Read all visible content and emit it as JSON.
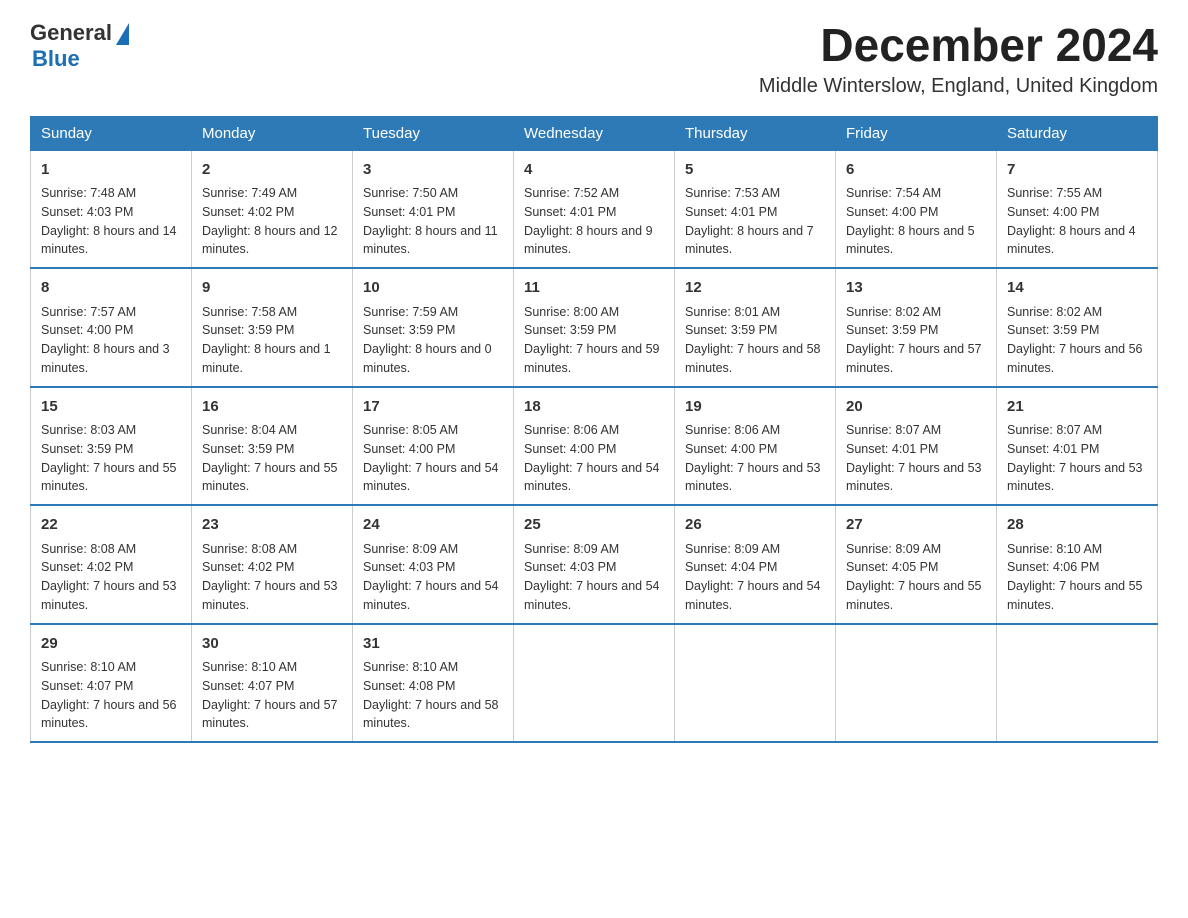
{
  "header": {
    "logo": {
      "general": "General",
      "arrow": "▶",
      "blue": "Blue"
    },
    "title": "December 2024",
    "subtitle": "Middle Winterslow, England, United Kingdom"
  },
  "calendar": {
    "days_of_week": [
      "Sunday",
      "Monday",
      "Tuesday",
      "Wednesday",
      "Thursday",
      "Friday",
      "Saturday"
    ],
    "weeks": [
      [
        {
          "day": "1",
          "sunrise": "7:48 AM",
          "sunset": "4:03 PM",
          "daylight": "8 hours and 14 minutes."
        },
        {
          "day": "2",
          "sunrise": "7:49 AM",
          "sunset": "4:02 PM",
          "daylight": "8 hours and 12 minutes."
        },
        {
          "day": "3",
          "sunrise": "7:50 AM",
          "sunset": "4:01 PM",
          "daylight": "8 hours and 11 minutes."
        },
        {
          "day": "4",
          "sunrise": "7:52 AM",
          "sunset": "4:01 PM",
          "daylight": "8 hours and 9 minutes."
        },
        {
          "day": "5",
          "sunrise": "7:53 AM",
          "sunset": "4:01 PM",
          "daylight": "8 hours and 7 minutes."
        },
        {
          "day": "6",
          "sunrise": "7:54 AM",
          "sunset": "4:00 PM",
          "daylight": "8 hours and 5 minutes."
        },
        {
          "day": "7",
          "sunrise": "7:55 AM",
          "sunset": "4:00 PM",
          "daylight": "8 hours and 4 minutes."
        }
      ],
      [
        {
          "day": "8",
          "sunrise": "7:57 AM",
          "sunset": "4:00 PM",
          "daylight": "8 hours and 3 minutes."
        },
        {
          "day": "9",
          "sunrise": "7:58 AM",
          "sunset": "3:59 PM",
          "daylight": "8 hours and 1 minute."
        },
        {
          "day": "10",
          "sunrise": "7:59 AM",
          "sunset": "3:59 PM",
          "daylight": "8 hours and 0 minutes."
        },
        {
          "day": "11",
          "sunrise": "8:00 AM",
          "sunset": "3:59 PM",
          "daylight": "7 hours and 59 minutes."
        },
        {
          "day": "12",
          "sunrise": "8:01 AM",
          "sunset": "3:59 PM",
          "daylight": "7 hours and 58 minutes."
        },
        {
          "day": "13",
          "sunrise": "8:02 AM",
          "sunset": "3:59 PM",
          "daylight": "7 hours and 57 minutes."
        },
        {
          "day": "14",
          "sunrise": "8:02 AM",
          "sunset": "3:59 PM",
          "daylight": "7 hours and 56 minutes."
        }
      ],
      [
        {
          "day": "15",
          "sunrise": "8:03 AM",
          "sunset": "3:59 PM",
          "daylight": "7 hours and 55 minutes."
        },
        {
          "day": "16",
          "sunrise": "8:04 AM",
          "sunset": "3:59 PM",
          "daylight": "7 hours and 55 minutes."
        },
        {
          "day": "17",
          "sunrise": "8:05 AM",
          "sunset": "4:00 PM",
          "daylight": "7 hours and 54 minutes."
        },
        {
          "day": "18",
          "sunrise": "8:06 AM",
          "sunset": "4:00 PM",
          "daylight": "7 hours and 54 minutes."
        },
        {
          "day": "19",
          "sunrise": "8:06 AM",
          "sunset": "4:00 PM",
          "daylight": "7 hours and 53 minutes."
        },
        {
          "day": "20",
          "sunrise": "8:07 AM",
          "sunset": "4:01 PM",
          "daylight": "7 hours and 53 minutes."
        },
        {
          "day": "21",
          "sunrise": "8:07 AM",
          "sunset": "4:01 PM",
          "daylight": "7 hours and 53 minutes."
        }
      ],
      [
        {
          "day": "22",
          "sunrise": "8:08 AM",
          "sunset": "4:02 PM",
          "daylight": "7 hours and 53 minutes."
        },
        {
          "day": "23",
          "sunrise": "8:08 AM",
          "sunset": "4:02 PM",
          "daylight": "7 hours and 53 minutes."
        },
        {
          "day": "24",
          "sunrise": "8:09 AM",
          "sunset": "4:03 PM",
          "daylight": "7 hours and 54 minutes."
        },
        {
          "day": "25",
          "sunrise": "8:09 AM",
          "sunset": "4:03 PM",
          "daylight": "7 hours and 54 minutes."
        },
        {
          "day": "26",
          "sunrise": "8:09 AM",
          "sunset": "4:04 PM",
          "daylight": "7 hours and 54 minutes."
        },
        {
          "day": "27",
          "sunrise": "8:09 AM",
          "sunset": "4:05 PM",
          "daylight": "7 hours and 55 minutes."
        },
        {
          "day": "28",
          "sunrise": "8:10 AM",
          "sunset": "4:06 PM",
          "daylight": "7 hours and 55 minutes."
        }
      ],
      [
        {
          "day": "29",
          "sunrise": "8:10 AM",
          "sunset": "4:07 PM",
          "daylight": "7 hours and 56 minutes."
        },
        {
          "day": "30",
          "sunrise": "8:10 AM",
          "sunset": "4:07 PM",
          "daylight": "7 hours and 57 minutes."
        },
        {
          "day": "31",
          "sunrise": "8:10 AM",
          "sunset": "4:08 PM",
          "daylight": "7 hours and 58 minutes."
        },
        null,
        null,
        null,
        null
      ]
    ]
  }
}
